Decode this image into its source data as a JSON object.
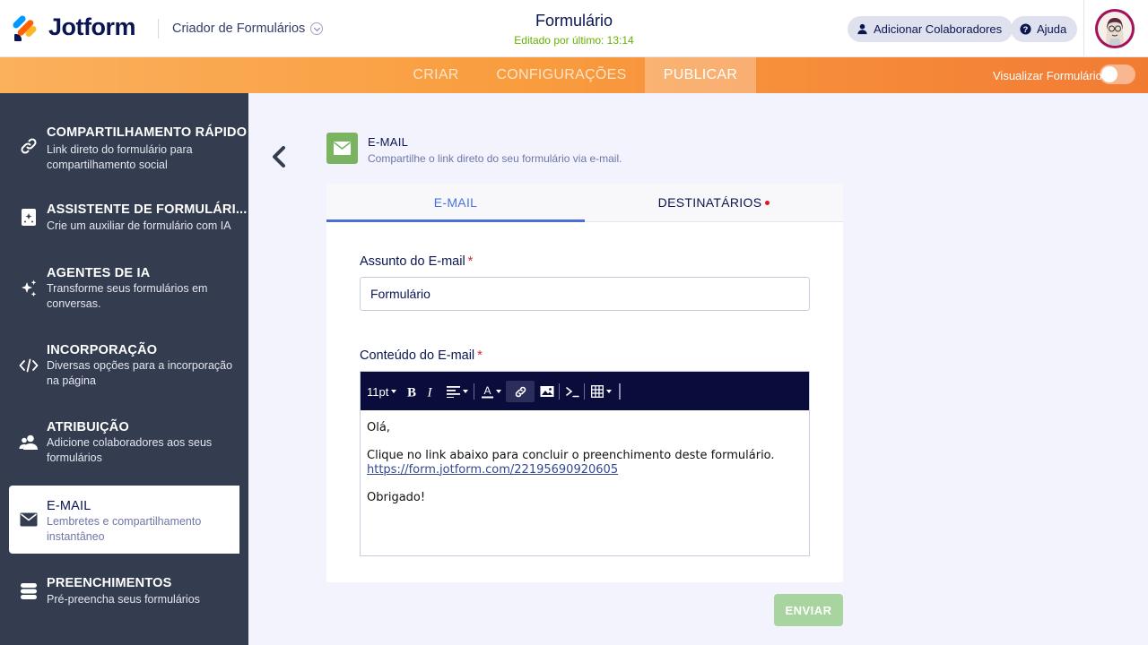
{
  "app": {
    "logo_text": "Jotform",
    "builder_name": "Criador de Formulários"
  },
  "header": {
    "form_title": "Formulário",
    "last_edited": "Editado por último: 13:14",
    "collaborators_label": "Adicionar Colaboradores",
    "help_label": "Ajuda"
  },
  "nav": {
    "tabs": [
      {
        "label": "CRIAR"
      },
      {
        "label": "CONFIGURAÇÕES"
      },
      {
        "label": "PUBLICAR"
      }
    ],
    "active_tab": "PUBLICAR",
    "preview_label": "Visualizar Formulário",
    "preview_enabled": false
  },
  "sidebar": {
    "items": [
      {
        "title": "COMPARTILHAMENTO RÁPIDO",
        "desc": "Link direto do formulário para compartilhamento social",
        "icon": "link-icon"
      },
      {
        "title": "ASSISTENTE DE FORMULÁRI...",
        "desc": "Crie um auxiliar de formulário com IA",
        "icon": "ai-assistant-icon"
      },
      {
        "title": "AGENTES DE IA",
        "desc": "Transforme seus formulários em conversas.",
        "icon": "sparkles-icon"
      },
      {
        "title": "INCORPORAÇÃO",
        "desc": "Diversas opções para a incorporação na página",
        "icon": "code-icon"
      },
      {
        "title": "ATRIBUIÇÃO",
        "desc": "Adicione colaboradores aos seus formulários",
        "icon": "users-icon"
      },
      {
        "title": "E-MAIL",
        "desc": "Lembretes e compartilhamento instantâneo",
        "icon": "envelope-icon"
      },
      {
        "title": "PREENCHIMENTOS",
        "desc": "Pré-preencha seus formulários",
        "icon": "database-icon"
      }
    ],
    "active_item": "E-MAIL"
  },
  "main": {
    "section_title": "E-MAIL",
    "section_subtitle": "Compartilhe o link direto do seu formulário via e-mail.",
    "tabs": [
      {
        "label": "E-MAIL"
      },
      {
        "label": "DESTINATÁRIOS"
      }
    ],
    "subject_label": "Assunto do E-mail",
    "subject_value": "Formulário",
    "content_label": "Conteúdo do E-mail",
    "required_mark": "*",
    "toolbar": {
      "font_size": "11pt"
    },
    "body": {
      "greeting": "Olá,",
      "line1": "Clique no link abaixo para concluir o preenchimento deste formulário.",
      "link": "https://form.jotform.com/22195690920605",
      "closing": "Obrigado!"
    },
    "send_label": "ENVIAR"
  },
  "colors": {
    "accent_blue": "#4a6ed4",
    "nav_orange": "#f99d3f",
    "sidebar_bg": "#343c4f",
    "send_green": "#a8d4a0",
    "email_icon_green": "#7bb461"
  }
}
